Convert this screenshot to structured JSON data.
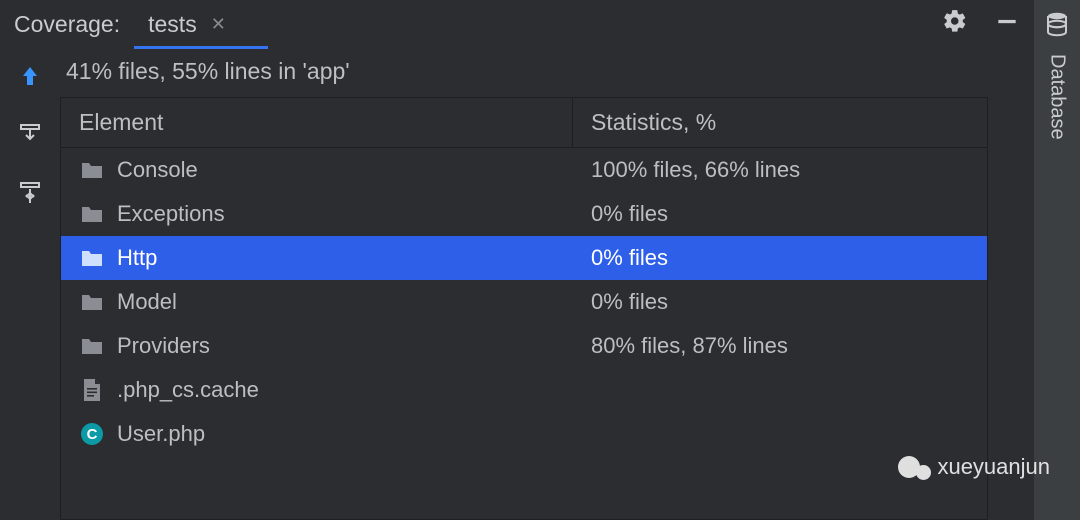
{
  "header": {
    "title": "Coverage:",
    "tab_label": "tests"
  },
  "summary": "41% files, 55% lines in 'app'",
  "columns": {
    "element": "Element",
    "stats": "Statistics, %"
  },
  "rows": [
    {
      "icon": "folder",
      "name": "Console",
      "stats": "100% files, 66% lines",
      "selected": false
    },
    {
      "icon": "folder",
      "name": "Exceptions",
      "stats": "0% files",
      "selected": false
    },
    {
      "icon": "folder",
      "name": "Http",
      "stats": "0% files",
      "selected": true
    },
    {
      "icon": "folder",
      "name": "Model",
      "stats": "0% files",
      "selected": false
    },
    {
      "icon": "folder",
      "name": "Providers",
      "stats": "80% files, 87% lines",
      "selected": false
    },
    {
      "icon": "file",
      "name": ".php_cs.cache",
      "stats": "",
      "selected": false
    },
    {
      "icon": "class",
      "name": "User.php",
      "stats": "",
      "selected": false
    }
  ],
  "sidebar": {
    "label": "Database"
  },
  "watermark": "xueyuanjun"
}
